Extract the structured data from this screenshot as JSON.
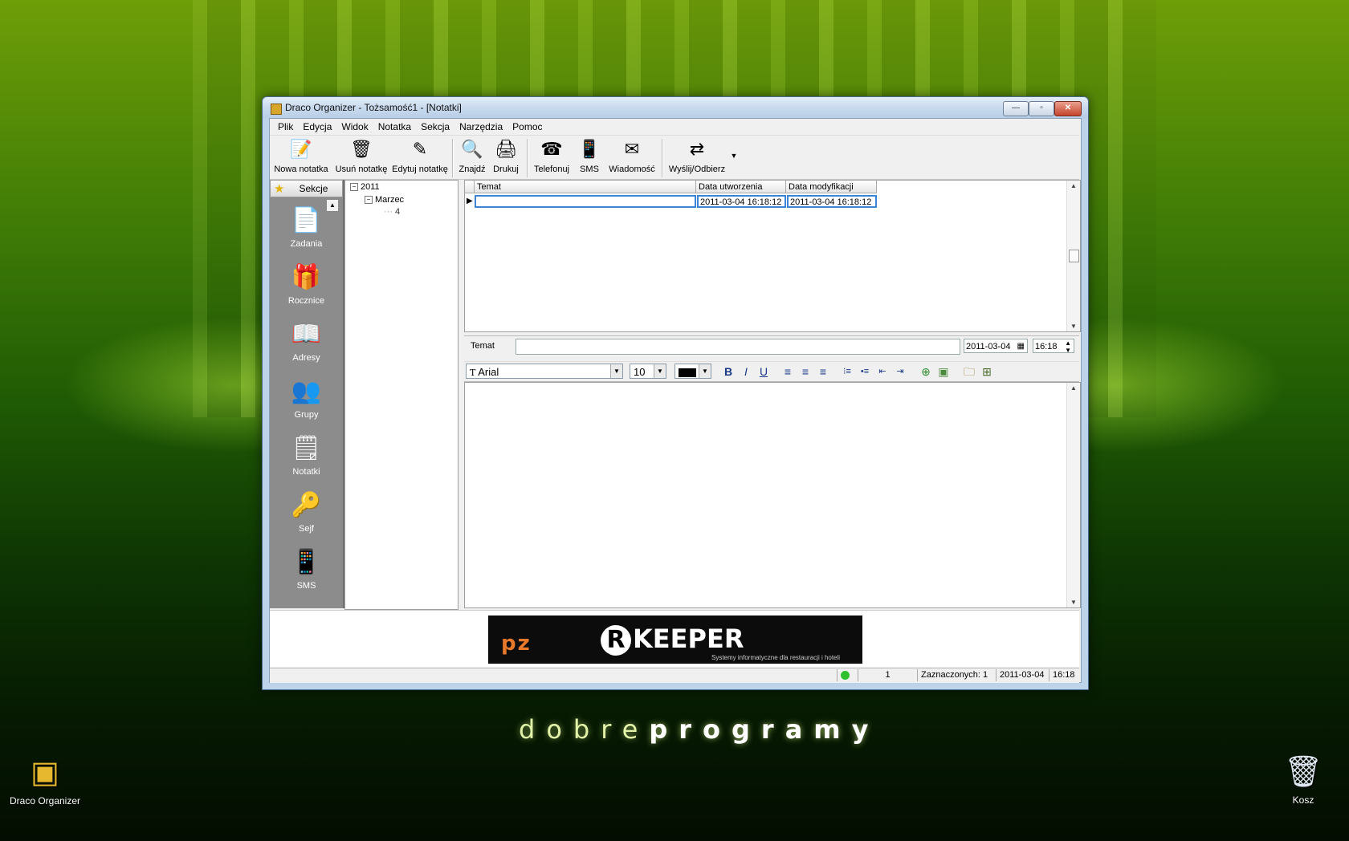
{
  "window": {
    "title": "Draco Organizer - Tożsamość1 - [Notatki]",
    "buttons": {
      "min": "—",
      "max": "▫",
      "close": "✕"
    }
  },
  "menu": [
    "Plik",
    "Edycja",
    "Widok",
    "Notatka",
    "Sekcja",
    "Narzędzia",
    "Pomoc"
  ],
  "toolbar": [
    {
      "label": "Nowa notatka",
      "icon": "new-note-icon"
    },
    {
      "label": "Usuń notatkę",
      "icon": "delete-note-icon"
    },
    {
      "label": "Edytuj notatkę",
      "icon": "edit-note-icon"
    },
    {
      "label": "Znajdź",
      "icon": "find-icon"
    },
    {
      "label": "Drukuj",
      "icon": "print-icon"
    },
    {
      "label": "Telefonuj",
      "icon": "phone-icon"
    },
    {
      "label": "SMS",
      "icon": "sms-icon"
    },
    {
      "label": "Wiadomość",
      "icon": "message-icon"
    },
    {
      "label": "Wyślij/Odbierz",
      "icon": "send-receive-icon"
    }
  ],
  "sections": {
    "header": "Sekcje",
    "items": [
      "Zadania",
      "Rocznice",
      "Adresy",
      "Grupy",
      "Notatki",
      "Sejf",
      "SMS"
    ]
  },
  "tree": {
    "year": "2011",
    "month": "Marzec",
    "day": "4"
  },
  "grid": {
    "columns": [
      "Temat",
      "Data utworzenia",
      "Data modyfikacji"
    ],
    "row": {
      "temat": "",
      "created": "2011-03-04 16:18:12",
      "modified": "2011-03-04 16:18:12"
    }
  },
  "subject": {
    "label": "Temat",
    "value": "",
    "date": "2011-03-04",
    "time": "16:18"
  },
  "format": {
    "font": "Arial",
    "size": "10",
    "bold": "B",
    "italic": "I",
    "underline": "U"
  },
  "ad": {
    "logo": "pz",
    "brand": "KEEPER",
    "brand_r": "R",
    "tagline": "Systemy informatyczne dla restauracji i hoteli"
  },
  "status": {
    "count": "1",
    "selected": "Zaznaczonych: 1",
    "date": "2011-03-04",
    "time": "16:18"
  },
  "desktop": {
    "brand_light": "dobre",
    "brand_bold": "programy",
    "icon_left": "Draco Organizer",
    "icon_right": "Kosz"
  },
  "colors": {
    "accent": "#3d83d8",
    "status_ok": "#2ec02e",
    "sidebar": "#8c8c8c"
  }
}
